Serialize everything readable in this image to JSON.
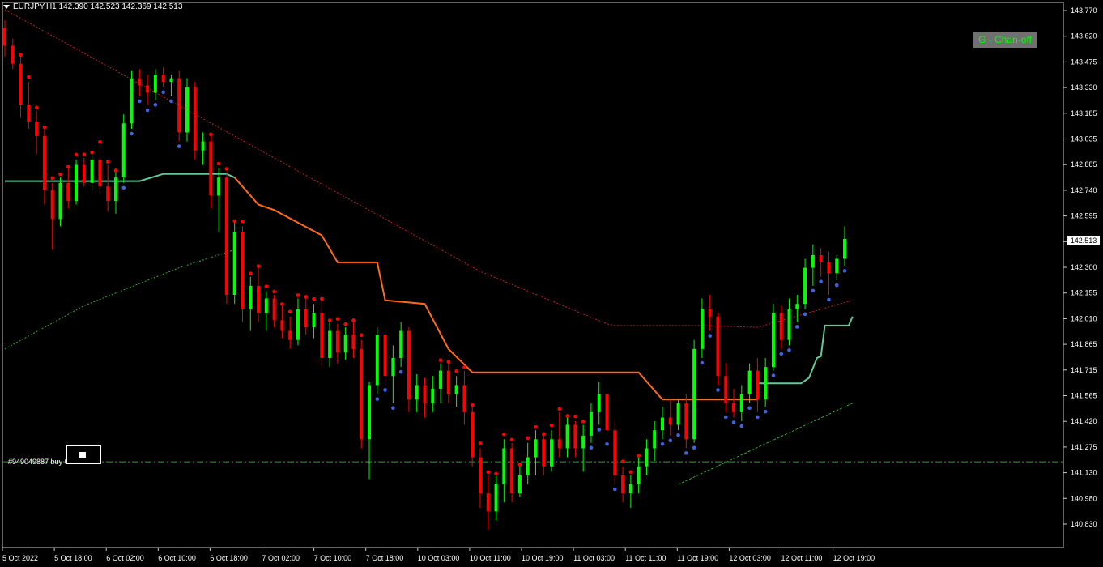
{
  "window": {
    "symbol_line": "EURJPY,H1  142.390 142.523 142.369 142.513"
  },
  "badge": {
    "label": "G - Chan-off"
  },
  "order": {
    "label": "#949049887 buy 0.01"
  },
  "current_price": "142.513",
  "colors": {
    "background": "#000000",
    "bull": "#00ff00",
    "bear": "#ff0000",
    "dots_red": "#ff0000",
    "dots_blue": "#3c64dc",
    "orange_line": "#ff6a1a",
    "teal_line": "#5fc99a",
    "red_dotted": "#c0201a",
    "green_dotted": "#2eaa2e",
    "order_line": "#2e9e2e"
  },
  "chart_data": {
    "type": "candlestick",
    "symbol": "EURJPY",
    "timeframe": "H1",
    "y_ticks": [
      "143.770",
      "143.620",
      "143.475",
      "143.330",
      "143.185",
      "143.035",
      "142.885",
      "142.740",
      "142.595",
      "142.450",
      "142.300",
      "142.155",
      "142.010",
      "141.865",
      "141.715",
      "141.565",
      "141.420",
      "141.275",
      "141.130",
      "140.980",
      "140.830"
    ],
    "x_ticks": [
      "5 Oct 2022",
      "5 Oct 18:00",
      "6 Oct 02:00",
      "6 Oct 10:00",
      "6 Oct 18:00",
      "7 Oct 02:00",
      "7 Oct 10:00",
      "7 Oct 18:00",
      "10 Oct 03:00",
      "10 Oct 11:00",
      "10 Oct 19:00",
      "11 Oct 03:00",
      "11 Oct 11:00",
      "11 Oct 19:00",
      "12 Oct 03:00",
      "12 Oct 11:00",
      "12 Oct 19:00"
    ],
    "ylim": [
      140.8,
      143.82
    ],
    "order_price": 141.275,
    "candles": [
      [
        143.68,
        143.72,
        143.52,
        143.58
      ],
      [
        143.58,
        143.62,
        143.45,
        143.48
      ],
      [
        143.48,
        143.52,
        143.18,
        143.25
      ],
      [
        143.25,
        143.38,
        143.12,
        143.16
      ],
      [
        143.16,
        143.22,
        142.98,
        143.08
      ],
      [
        143.08,
        143.12,
        142.7,
        142.78
      ],
      [
        142.78,
        142.82,
        142.45,
        142.62
      ],
      [
        142.62,
        142.85,
        142.58,
        142.82
      ],
      [
        142.82,
        142.9,
        142.68,
        142.72
      ],
      [
        142.72,
        142.95,
        142.7,
        142.92
      ],
      [
        142.92,
        142.96,
        142.8,
        142.82
      ],
      [
        142.82,
        142.98,
        142.78,
        142.95
      ],
      [
        142.95,
        143.02,
        142.76,
        142.8
      ],
      [
        142.8,
        142.92,
        142.66,
        142.72
      ],
      [
        142.72,
        142.88,
        142.65,
        142.85
      ],
      [
        142.85,
        143.2,
        142.82,
        143.15
      ],
      [
        143.15,
        143.44,
        143.12,
        143.4
      ],
      [
        143.4,
        143.45,
        143.3,
        143.36
      ],
      [
        143.36,
        143.42,
        143.25,
        143.32
      ],
      [
        143.32,
        143.45,
        143.28,
        143.42
      ],
      [
        143.42,
        143.46,
        143.35,
        143.38
      ],
      [
        143.38,
        143.42,
        143.3,
        143.4
      ],
      [
        143.4,
        143.44,
        143.05,
        143.1
      ],
      [
        143.1,
        143.4,
        143.05,
        143.35
      ],
      [
        143.35,
        143.38,
        142.95,
        143.0
      ],
      [
        143.0,
        143.1,
        142.92,
        143.05
      ],
      [
        143.05,
        143.08,
        142.68,
        142.75
      ],
      [
        142.75,
        142.9,
        142.55,
        142.85
      ],
      [
        142.85,
        142.88,
        142.15,
        142.2
      ],
      [
        142.2,
        142.6,
        142.15,
        142.55
      ],
      [
        142.55,
        142.58,
        142.05,
        142.12
      ],
      [
        142.12,
        142.3,
        142.0,
        142.25
      ],
      [
        142.25,
        142.35,
        142.05,
        142.1
      ],
      [
        142.1,
        142.22,
        142.0,
        142.18
      ],
      [
        142.18,
        142.2,
        142.02,
        142.06
      ],
      [
        142.06,
        142.14,
        141.96,
        142.0
      ],
      [
        142.0,
        142.08,
        141.9,
        141.95
      ],
      [
        141.95,
        142.18,
        141.92,
        142.12
      ],
      [
        142.12,
        142.18,
        141.98,
        142.02
      ],
      [
        142.02,
        142.15,
        141.96,
        142.1
      ],
      [
        142.1,
        142.16,
        141.8,
        141.85
      ],
      [
        141.85,
        142.05,
        141.8,
        142.0
      ],
      [
        142.0,
        142.04,
        141.82,
        141.88
      ],
      [
        141.88,
        142.02,
        141.84,
        141.98
      ],
      [
        141.98,
        142.05,
        141.85,
        141.9
      ],
      [
        141.9,
        141.95,
        141.35,
        141.4
      ],
      [
        141.4,
        141.72,
        141.18,
        141.7
      ],
      [
        141.7,
        142.02,
        141.65,
        141.98
      ],
      [
        141.98,
        142.0,
        141.7,
        141.75
      ],
      [
        141.75,
        141.92,
        141.6,
        141.85
      ],
      [
        141.85,
        142.05,
        141.8,
        142.0
      ],
      [
        142.0,
        142.02,
        141.55,
        141.62
      ],
      [
        141.62,
        141.76,
        141.55,
        141.7
      ],
      [
        141.7,
        141.74,
        141.52,
        141.6
      ],
      [
        141.6,
        141.75,
        141.55,
        141.68
      ],
      [
        141.68,
        141.82,
        141.6,
        141.78
      ],
      [
        141.78,
        141.82,
        141.6,
        141.65
      ],
      [
        141.65,
        141.75,
        141.58,
        141.7
      ],
      [
        141.7,
        141.78,
        141.48,
        141.55
      ],
      [
        141.55,
        141.58,
        141.25,
        141.3
      ],
      [
        141.3,
        141.35,
        141.02,
        141.1
      ],
      [
        141.1,
        141.2,
        140.9,
        141.0
      ],
      [
        141.0,
        141.2,
        140.95,
        141.15
      ],
      [
        141.15,
        141.4,
        141.05,
        141.35
      ],
      [
        141.35,
        141.38,
        141.05,
        141.1
      ],
      [
        141.1,
        141.25,
        141.08,
        141.2
      ],
      [
        141.2,
        141.38,
        141.15,
        141.3
      ],
      [
        141.3,
        141.45,
        141.2,
        141.4
      ],
      [
        141.4,
        141.42,
        141.2,
        141.25
      ],
      [
        141.25,
        141.45,
        141.22,
        141.4
      ],
      [
        141.4,
        141.55,
        141.3,
        141.35
      ],
      [
        141.35,
        141.52,
        141.3,
        141.48
      ],
      [
        141.48,
        141.5,
        141.3,
        141.35
      ],
      [
        141.35,
        141.48,
        141.22,
        141.42
      ],
      [
        141.42,
        141.6,
        141.38,
        141.55
      ],
      [
        141.55,
        141.72,
        141.48,
        141.65
      ],
      [
        141.65,
        141.68,
        141.4,
        141.45
      ],
      [
        141.45,
        141.5,
        141.15,
        141.2
      ],
      [
        141.2,
        141.25,
        141.05,
        141.1
      ],
      [
        141.1,
        141.2,
        141.02,
        141.15
      ],
      [
        141.15,
        141.3,
        141.1,
        141.25
      ],
      [
        141.25,
        141.4,
        141.2,
        141.35
      ],
      [
        141.35,
        141.5,
        141.28,
        141.45
      ],
      [
        141.45,
        141.58,
        141.4,
        141.52
      ],
      [
        141.52,
        141.62,
        141.42,
        141.48
      ],
      [
        141.48,
        141.62,
        141.45,
        141.6
      ],
      [
        141.6,
        141.65,
        141.35,
        141.4
      ],
      [
        141.4,
        141.95,
        141.38,
        141.9
      ],
      [
        141.9,
        142.18,
        141.85,
        142.12
      ],
      [
        142.12,
        142.2,
        142.0,
        142.08
      ],
      [
        142.08,
        142.1,
        141.7,
        141.75
      ],
      [
        141.75,
        141.82,
        141.55,
        141.6
      ],
      [
        141.6,
        141.68,
        141.52,
        141.55
      ],
      [
        141.55,
        141.7,
        141.5,
        141.65
      ],
      [
        141.65,
        141.82,
        141.6,
        141.78
      ],
      [
        141.78,
        141.85,
        141.55,
        141.62
      ],
      [
        141.62,
        141.85,
        141.58,
        141.8
      ],
      [
        141.8,
        142.15,
        141.78,
        142.1
      ],
      [
        142.1,
        142.14,
        141.9,
        141.95
      ],
      [
        141.95,
        142.18,
        141.92,
        142.12
      ],
      [
        142.12,
        142.2,
        142.05,
        142.15
      ],
      [
        142.15,
        142.4,
        142.12,
        142.35
      ],
      [
        142.35,
        142.48,
        142.25,
        142.42
      ],
      [
        142.42,
        142.46,
        142.3,
        142.38
      ],
      [
        142.38,
        142.44,
        142.2,
        142.32
      ],
      [
        142.32,
        142.42,
        142.28,
        142.4
      ],
      [
        142.4,
        142.58,
        142.36,
        142.51
      ]
    ]
  }
}
